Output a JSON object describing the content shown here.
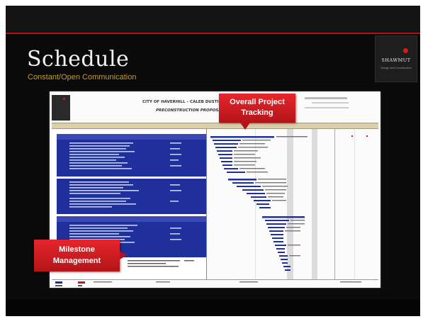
{
  "slide": {
    "title": "Schedule",
    "subtitle": "Constant/Open Communication"
  },
  "logo": {
    "name": "SHAWMUT",
    "tagline": "Design and Construction"
  },
  "document": {
    "title_line1": "CITY OF HAVERHILL – CALEB DUSTIN",
    "title_line2": "PRECONSTRUCTION PROPOSAL"
  },
  "callouts": {
    "project_tracking": {
      "line1": "Overall Project",
      "line2": "Tracking"
    },
    "milestone": {
      "line1": "Milestone",
      "line2": "Management"
    }
  },
  "colors": {
    "background": "#0a0a0a",
    "accent_red": "#c8161d",
    "subtitle_gold": "#c89a1e",
    "table_blue": "#1f2f9b",
    "header_tan": "#d9cfa8"
  }
}
